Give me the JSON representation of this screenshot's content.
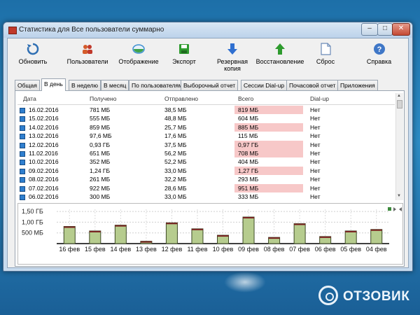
{
  "window": {
    "title": "Статистика для Все пользователи суммарно",
    "btn_min": "–",
    "btn_max": "□",
    "btn_close": "✕"
  },
  "toolbar": [
    {
      "label": "Обновить",
      "icon": "refresh-icon",
      "color": "#2f6fb3"
    },
    {
      "label": "Пользователи",
      "icon": "users-icon",
      "color": "#d45b2a"
    },
    {
      "label": "Отображение",
      "icon": "display-icon",
      "color": "#3b8fd0"
    },
    {
      "label": "Экспорт",
      "icon": "export-icon",
      "color": "#2e9b2e"
    },
    {
      "label": "Резервная копия",
      "icon": "backup-icon",
      "color": "#2f6fd0"
    },
    {
      "label": "Восстановление",
      "icon": "restore-icon",
      "color": "#2e9b2e"
    },
    {
      "label": "Сброс",
      "icon": "reset-icon",
      "color": "#6a8ab8"
    },
    {
      "label": "Справка",
      "icon": "help-icon",
      "color": "#3f77c7"
    }
  ],
  "tabs": [
    "Общая",
    "В день",
    "В неделю",
    "В месяц",
    "По пользователям",
    "Выборочный отчет",
    "Сессии Dial-up",
    "Почасовой отчет",
    "Приложения"
  ],
  "active_tab": "В день",
  "table": {
    "columns": [
      "Дата",
      "Получено",
      "Отправлено",
      "Всего",
      "Dial-up"
    ],
    "rows": [
      {
        "date": "16.02.2016",
        "received": "781 МБ",
        "sent": "38,5 МБ",
        "total": "819 МБ",
        "dialup": "Нет",
        "highlight": true
      },
      {
        "date": "15.02.2016",
        "received": "555 МБ",
        "sent": "48,8 МБ",
        "total": "604 МБ",
        "dialup": "Нет",
        "highlight": false
      },
      {
        "date": "14.02.2016",
        "received": "859 МБ",
        "sent": "25,7 МБ",
        "total": "885 МБ",
        "dialup": "Нет",
        "highlight": true
      },
      {
        "date": "13.02.2016",
        "received": "97,6 МБ",
        "sent": "17,6 МБ",
        "total": "115 МБ",
        "dialup": "Нет",
        "highlight": false
      },
      {
        "date": "12.02.2016",
        "received": "0,93 ГБ",
        "sent": "37,5 МБ",
        "total": "0,97 ГБ",
        "dialup": "Нет",
        "highlight": true
      },
      {
        "date": "11.02.2016",
        "received": "651 МБ",
        "sent": "56,2 МБ",
        "total": "708 МБ",
        "dialup": "Нет",
        "highlight": true
      },
      {
        "date": "10.02.2016",
        "received": "352 МБ",
        "sent": "52,2 МБ",
        "total": "404 МБ",
        "dialup": "Нет",
        "highlight": false
      },
      {
        "date": "09.02.2016",
        "received": "1,24 ГБ",
        "sent": "33,0 МБ",
        "total": "1,27 ГБ",
        "dialup": "Нет",
        "highlight": true
      },
      {
        "date": "08.02.2016",
        "received": "261 МБ",
        "sent": "32,2 МБ",
        "total": "293 МБ",
        "dialup": "Нет",
        "highlight": false
      },
      {
        "date": "07.02.2016",
        "received": "922 МБ",
        "sent": "28,6 МБ",
        "total": "951 МБ",
        "dialup": "Нет",
        "highlight": true
      },
      {
        "date": "06.02.2016",
        "received": "300 МБ",
        "sent": "33,0 МБ",
        "total": "333 МБ",
        "dialup": "Нет",
        "highlight": false
      }
    ]
  },
  "chart_data": {
    "type": "bar",
    "categories": [
      "16 фев",
      "15 фев",
      "14 фев",
      "13 фев",
      "12 фев",
      "11 фев",
      "10 фев",
      "09 фев",
      "08 фев",
      "07 фев",
      "06 фев",
      "05 фев",
      "04 фев"
    ],
    "values_gb": [
      0.8,
      0.59,
      0.86,
      0.11,
      0.97,
      0.69,
      0.39,
      1.24,
      0.29,
      0.93,
      0.33,
      0.59,
      0.66
    ],
    "y_tick_labels": [
      "1,50 ГБ",
      "1,00 ГБ",
      "500 МБ"
    ],
    "y_ticks": [
      1.5,
      1.0,
      0.5
    ],
    "ylim": [
      0,
      1.6
    ],
    "bar_color": "#b6cc8e",
    "grid": true
  },
  "watermark": {
    "text": "ОТЗОВИК"
  }
}
